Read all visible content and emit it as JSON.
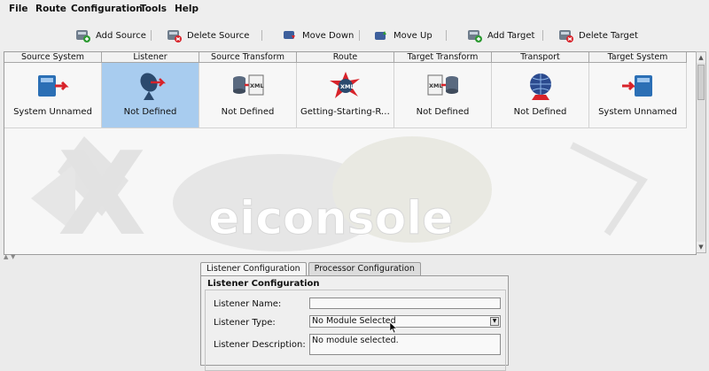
{
  "menu": {
    "file": "File",
    "route": "Route",
    "configuration": "Configuration",
    "tools": "Tools",
    "help": "Help"
  },
  "toolbar": {
    "add_source": "Add Source",
    "delete_source": "Delete Source",
    "move_down": "Move Down",
    "move_up": "Move Up",
    "add_target": "Add Target",
    "delete_target": "Delete Target"
  },
  "grid": {
    "headers": [
      "Source System",
      "Listener",
      "Source Transform",
      "Route",
      "Target Transform",
      "Transport",
      "Target System"
    ],
    "cells": [
      {
        "label": "System Unnamed",
        "icon": "source-system-icon"
      },
      {
        "label": "Not Defined",
        "icon": "listener-dish-icon"
      },
      {
        "label": "Not Defined",
        "icon": "xml-source-transform-icon"
      },
      {
        "label": "Getting-Starting-Resp...",
        "icon": "xml-route-icon"
      },
      {
        "label": "Not Defined",
        "icon": "xml-target-transform-icon"
      },
      {
        "label": "Not Defined",
        "icon": "globe-transport-icon"
      },
      {
        "label": "System Unnamed",
        "icon": "target-system-icon"
      }
    ],
    "selected_index": 1,
    "watermark": "eiconsole"
  },
  "tabs": [
    "Listener Configuration",
    "Processor Configuration"
  ],
  "panel": {
    "title": "Listener Configuration",
    "name_label": "Listener Name:",
    "name_value": "",
    "type_label": "Listener Type:",
    "type_value": "No Module Selected",
    "desc_label": "Listener Description:",
    "desc_value": "No module selected."
  },
  "colors": {
    "selection": "#a8ccef",
    "accent_red": "#d8232a",
    "accent_blue": "#2b6fb5"
  }
}
